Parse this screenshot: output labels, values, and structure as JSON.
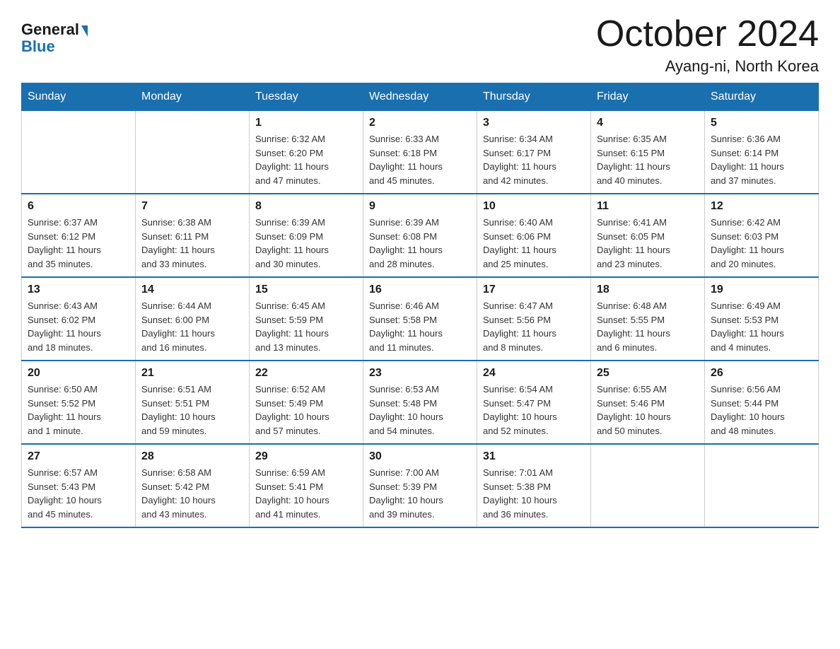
{
  "header": {
    "logo_general": "General",
    "logo_blue": "Blue",
    "month_title": "October 2024",
    "location": "Ayang-ni, North Korea"
  },
  "weekdays": [
    "Sunday",
    "Monday",
    "Tuesday",
    "Wednesday",
    "Thursday",
    "Friday",
    "Saturday"
  ],
  "weeks": [
    [
      {
        "day": "",
        "info": ""
      },
      {
        "day": "",
        "info": ""
      },
      {
        "day": "1",
        "info": "Sunrise: 6:32 AM\nSunset: 6:20 PM\nDaylight: 11 hours\nand 47 minutes."
      },
      {
        "day": "2",
        "info": "Sunrise: 6:33 AM\nSunset: 6:18 PM\nDaylight: 11 hours\nand 45 minutes."
      },
      {
        "day": "3",
        "info": "Sunrise: 6:34 AM\nSunset: 6:17 PM\nDaylight: 11 hours\nand 42 minutes."
      },
      {
        "day": "4",
        "info": "Sunrise: 6:35 AM\nSunset: 6:15 PM\nDaylight: 11 hours\nand 40 minutes."
      },
      {
        "day": "5",
        "info": "Sunrise: 6:36 AM\nSunset: 6:14 PM\nDaylight: 11 hours\nand 37 minutes."
      }
    ],
    [
      {
        "day": "6",
        "info": "Sunrise: 6:37 AM\nSunset: 6:12 PM\nDaylight: 11 hours\nand 35 minutes."
      },
      {
        "day": "7",
        "info": "Sunrise: 6:38 AM\nSunset: 6:11 PM\nDaylight: 11 hours\nand 33 minutes."
      },
      {
        "day": "8",
        "info": "Sunrise: 6:39 AM\nSunset: 6:09 PM\nDaylight: 11 hours\nand 30 minutes."
      },
      {
        "day": "9",
        "info": "Sunrise: 6:39 AM\nSunset: 6:08 PM\nDaylight: 11 hours\nand 28 minutes."
      },
      {
        "day": "10",
        "info": "Sunrise: 6:40 AM\nSunset: 6:06 PM\nDaylight: 11 hours\nand 25 minutes."
      },
      {
        "day": "11",
        "info": "Sunrise: 6:41 AM\nSunset: 6:05 PM\nDaylight: 11 hours\nand 23 minutes."
      },
      {
        "day": "12",
        "info": "Sunrise: 6:42 AM\nSunset: 6:03 PM\nDaylight: 11 hours\nand 20 minutes."
      }
    ],
    [
      {
        "day": "13",
        "info": "Sunrise: 6:43 AM\nSunset: 6:02 PM\nDaylight: 11 hours\nand 18 minutes."
      },
      {
        "day": "14",
        "info": "Sunrise: 6:44 AM\nSunset: 6:00 PM\nDaylight: 11 hours\nand 16 minutes."
      },
      {
        "day": "15",
        "info": "Sunrise: 6:45 AM\nSunset: 5:59 PM\nDaylight: 11 hours\nand 13 minutes."
      },
      {
        "day": "16",
        "info": "Sunrise: 6:46 AM\nSunset: 5:58 PM\nDaylight: 11 hours\nand 11 minutes."
      },
      {
        "day": "17",
        "info": "Sunrise: 6:47 AM\nSunset: 5:56 PM\nDaylight: 11 hours\nand 8 minutes."
      },
      {
        "day": "18",
        "info": "Sunrise: 6:48 AM\nSunset: 5:55 PM\nDaylight: 11 hours\nand 6 minutes."
      },
      {
        "day": "19",
        "info": "Sunrise: 6:49 AM\nSunset: 5:53 PM\nDaylight: 11 hours\nand 4 minutes."
      }
    ],
    [
      {
        "day": "20",
        "info": "Sunrise: 6:50 AM\nSunset: 5:52 PM\nDaylight: 11 hours\nand 1 minute."
      },
      {
        "day": "21",
        "info": "Sunrise: 6:51 AM\nSunset: 5:51 PM\nDaylight: 10 hours\nand 59 minutes."
      },
      {
        "day": "22",
        "info": "Sunrise: 6:52 AM\nSunset: 5:49 PM\nDaylight: 10 hours\nand 57 minutes."
      },
      {
        "day": "23",
        "info": "Sunrise: 6:53 AM\nSunset: 5:48 PM\nDaylight: 10 hours\nand 54 minutes."
      },
      {
        "day": "24",
        "info": "Sunrise: 6:54 AM\nSunset: 5:47 PM\nDaylight: 10 hours\nand 52 minutes."
      },
      {
        "day": "25",
        "info": "Sunrise: 6:55 AM\nSunset: 5:46 PM\nDaylight: 10 hours\nand 50 minutes."
      },
      {
        "day": "26",
        "info": "Sunrise: 6:56 AM\nSunset: 5:44 PM\nDaylight: 10 hours\nand 48 minutes."
      }
    ],
    [
      {
        "day": "27",
        "info": "Sunrise: 6:57 AM\nSunset: 5:43 PM\nDaylight: 10 hours\nand 45 minutes."
      },
      {
        "day": "28",
        "info": "Sunrise: 6:58 AM\nSunset: 5:42 PM\nDaylight: 10 hours\nand 43 minutes."
      },
      {
        "day": "29",
        "info": "Sunrise: 6:59 AM\nSunset: 5:41 PM\nDaylight: 10 hours\nand 41 minutes."
      },
      {
        "day": "30",
        "info": "Sunrise: 7:00 AM\nSunset: 5:39 PM\nDaylight: 10 hours\nand 39 minutes."
      },
      {
        "day": "31",
        "info": "Sunrise: 7:01 AM\nSunset: 5:38 PM\nDaylight: 10 hours\nand 36 minutes."
      },
      {
        "day": "",
        "info": ""
      },
      {
        "day": "",
        "info": ""
      }
    ]
  ]
}
